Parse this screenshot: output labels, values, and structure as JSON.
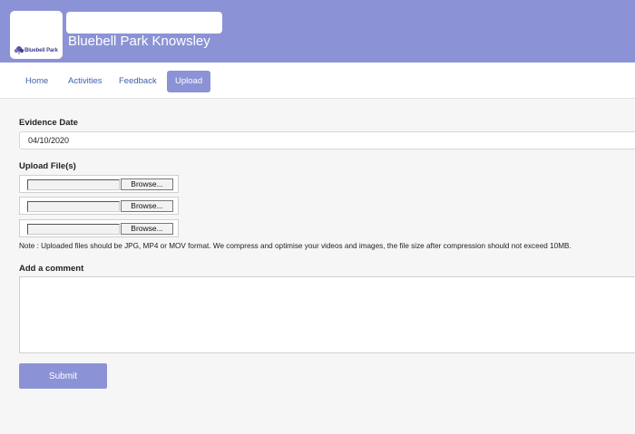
{
  "header": {
    "logo_text": "Bluebell Park",
    "title": "Bluebell Park Knowsley"
  },
  "nav": {
    "items": [
      {
        "label": "Home"
      },
      {
        "label": "Activities"
      },
      {
        "label": "Feedback"
      },
      {
        "label": "Upload",
        "active": true
      }
    ]
  },
  "form": {
    "evidence_date_label": "Evidence Date",
    "evidence_date_value": "04/10/2020",
    "upload_label": "Upload File(s)",
    "browse_label": "Browse...",
    "note": "Note : Uploaded files should be JPG, MP4 or MOV format. We compress and optimise your videos and images, the file size after compression should not exceed 10MB.",
    "comment_label": "Add a comment",
    "comment_value": "",
    "submit_label": "Submit"
  },
  "colors": {
    "accent": "#8b93d6",
    "link": "#3a5fb0",
    "background": "#f6f6f6"
  }
}
